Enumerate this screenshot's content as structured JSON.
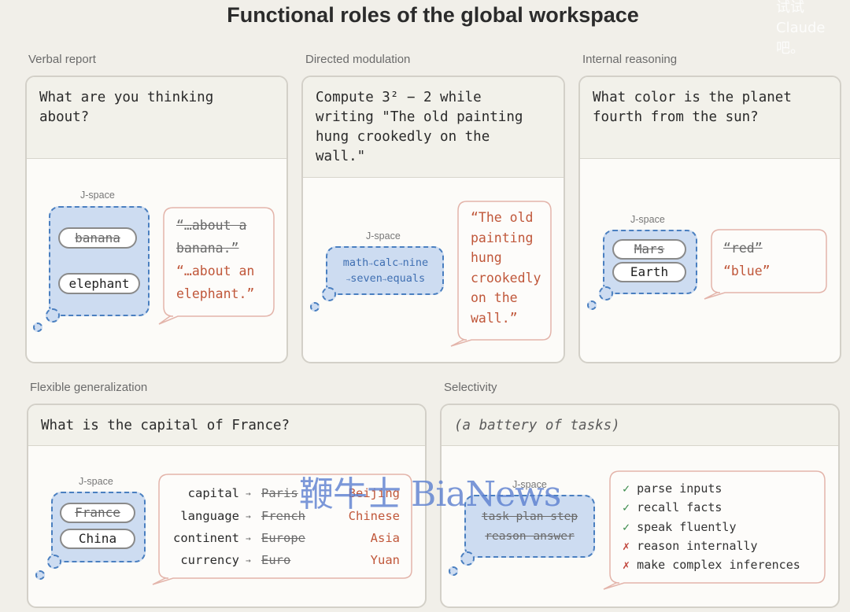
{
  "title": "Functional roles of the global workspace",
  "watermark_corner": "试试\nClaude\n吧。",
  "watermark_center": "鞭牛士 BiaNews",
  "j_label": "J-space",
  "panels": {
    "verbal": {
      "label": "Verbal report",
      "prompt": "What are you thinking\nabout?",
      "concepts": [
        "banana",
        "elephant"
      ],
      "reply_old": "“…about a banana.”",
      "reply_old_1": "“…about a",
      "reply_old_2": "banana.”",
      "reply_new_1": "“…about an",
      "reply_new_2": "elephant.”"
    },
    "directed": {
      "label": "Directed modulation",
      "prompt": "Compute 3² − 2 while\nwriting \"The old painting\nhung crookedly on the\nwall.\"",
      "j_words": [
        "math",
        "calc",
        "nine",
        "seven",
        "equals"
      ],
      "reply": [
        "“The old",
        "painting",
        "hung",
        "crookedly",
        "on the",
        "wall.”"
      ]
    },
    "internal": {
      "label": "Internal reasoning",
      "prompt": "What color is the planet\nfourth from the sun?",
      "concepts": [
        "Mars",
        "Earth"
      ],
      "reply_old": "“red”",
      "reply_new": "“blue”"
    },
    "flexible": {
      "label": "Flexible generalization",
      "prompt": "What is the capital of France?",
      "concepts": [
        "France",
        "China"
      ],
      "rows": [
        {
          "key": "capital",
          "old": "Paris",
          "new": "Beijing"
        },
        {
          "key": "language",
          "old": "French",
          "new": "Chinese"
        },
        {
          "key": "continent",
          "old": "Europe",
          "new": "Asia"
        },
        {
          "key": "currency",
          "old": "Euro",
          "new": "Yuan"
        }
      ]
    },
    "selectivity": {
      "label": "Selectivity",
      "prompt": "(a battery of tasks)",
      "j_words_1": "task plan step",
      "j_words_2": "reason answer",
      "tasks": [
        {
          "mark": "✓",
          "ok": true,
          "text": "parse inputs"
        },
        {
          "mark": "✓",
          "ok": true,
          "text": "recall facts"
        },
        {
          "mark": "✓",
          "ok": true,
          "text": "speak fluently"
        },
        {
          "mark": "✗",
          "ok": false,
          "text": "reason internally"
        },
        {
          "mark": "✗",
          "ok": false,
          "text": "make complex inferences"
        }
      ]
    }
  }
}
